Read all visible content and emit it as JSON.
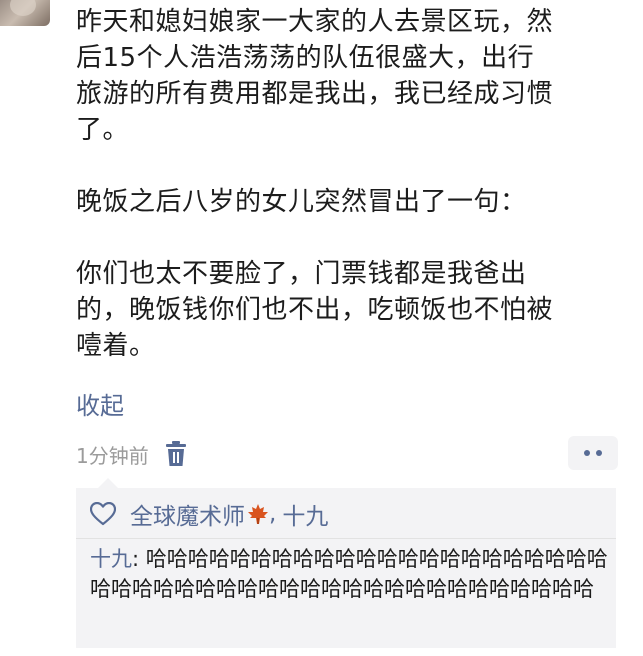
{
  "post": {
    "text": "昨天和媳妇娘家一大家的人去景区玩，然\n后15个人浩浩荡荡的队伍很盛大，出行\n旅游的所有费用都是我出，我已经成习惯\n了。\n\n晚饭之后八岁的女儿突然冒出了一句：\n\n你们也太不要脸了，门票钱都是我爸出\n的，晚饭钱你们也不出，吃顿饭也不怕被\n噎着。",
    "collapse_label": "收起",
    "timestamp": "1分钟前"
  },
  "likes": {
    "liker1": "全球魔术师",
    "separator": ",",
    "liker2": "十九"
  },
  "comment": {
    "author": "十九",
    "separator": ": ",
    "text": "哈哈哈哈哈哈哈哈哈哈哈哈哈哈哈哈哈哈哈哈哈哈哈哈哈哈哈哈哈哈哈哈哈哈哈哈哈哈哈哈哈哈哈哈哈哈"
  },
  "icons": {
    "delete": "trash-icon",
    "more": "more-icon",
    "like": "heart-icon",
    "emoji": "maple-leaf-icon"
  },
  "colors": {
    "link": "#576b95",
    "comment_bg": "#f3f3f5",
    "text": "#1c1c1c",
    "muted": "#9b9b9b",
    "maple": "#d9541f"
  }
}
